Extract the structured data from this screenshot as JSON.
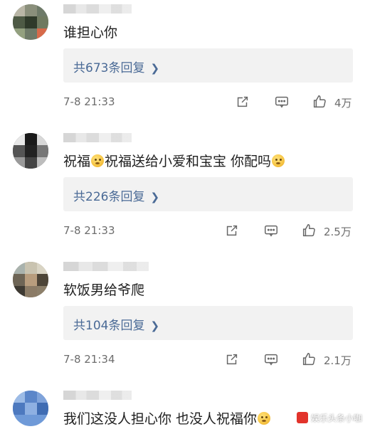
{
  "comments": [
    {
      "text": "谁担心你",
      "reply_label": "共673条回复",
      "timestamp": "7-8 21:33",
      "likes": "4万"
    },
    {
      "text_parts": [
        "祝福",
        "祝福送给小爱和宝宝 你配吗"
      ],
      "reply_label": "共226条回复",
      "timestamp": "7-8 21:33",
      "likes": "2.5万"
    },
    {
      "text": "软饭男给爷爬",
      "reply_label": "共104条回复",
      "timestamp": "7-8 21:34",
      "likes": "2.1万"
    },
    {
      "text": "我们这没人担心你 也没人祝福你"
    }
  ],
  "icons": {
    "repost": "repost-icon",
    "comment": "comment-icon",
    "like": "like-icon",
    "chevron": "chevron-right-icon",
    "emoji": "emoji-icon"
  },
  "colors": {
    "reply_link": "#4a6a96",
    "reply_box_bg": "#f2f2f2",
    "meta_text": "#6d6d6d"
  },
  "watermark": {
    "text": "娱乐头条小咖"
  }
}
